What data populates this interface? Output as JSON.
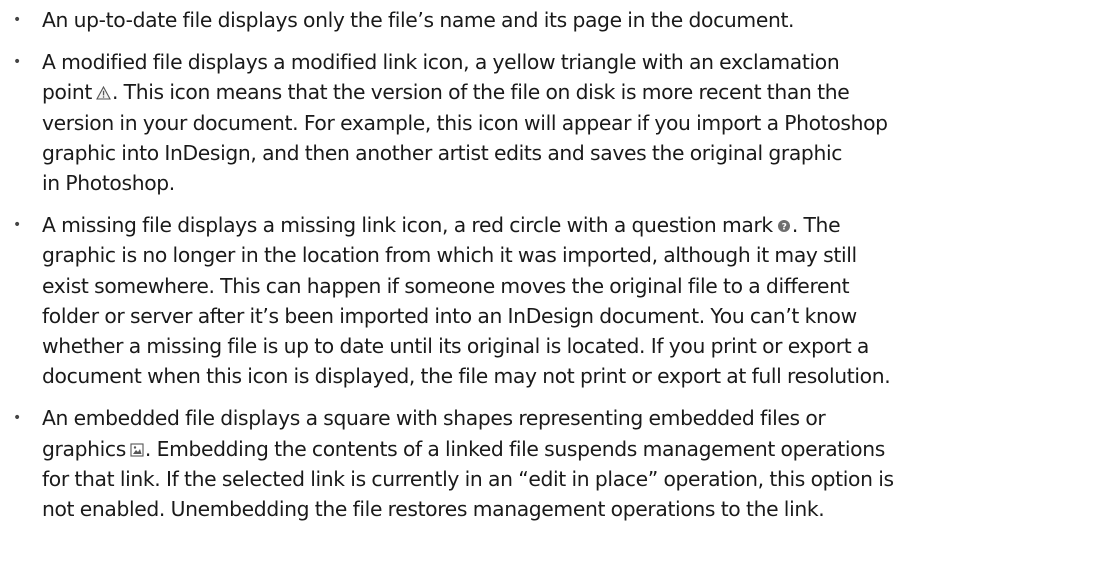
{
  "items": [
    {
      "lines": [
        "An up-to-date file displays only the file’s name and its page in the document."
      ]
    },
    {
      "lines": [
        "A modified file displays a modified link icon, a yellow triangle with an exclamation",
        "point",
        ". This icon means that the version of the file on disk is more recent than the",
        "version in your document. For example, this icon will appear if you import a Photoshop",
        "graphic into InDesign, and then another artist edits and saves the original graphic",
        "in Photoshop."
      ]
    },
    {
      "lines": [
        "A missing file displays a missing link icon, a red circle with a question mark",
        ". The",
        "graphic is no longer in the location from which it was imported, although it may still",
        "exist somewhere. This can happen if someone moves the original file to a different",
        "folder or server after it’s been imported into an InDesign document. You can’t know",
        "whether a missing file is up to date until its original is located. If you print or export a",
        "document when this icon is displayed, the file may not print or export at full resolution."
      ]
    },
    {
      "lines": [
        "An embedded file displays a square with shapes representing embedded files or",
        "graphics",
        ". Embedding the contents of a linked file suspends management operations",
        "for that link. If the selected link is currently in an “edit in place” operation, this option is",
        "not enabled. Unembedding the file restores management operations to the link."
      ]
    }
  ],
  "icons": {
    "modified": "warning-triangle-icon",
    "missing": "missing-link-icon",
    "embedded": "embedded-file-icon"
  }
}
